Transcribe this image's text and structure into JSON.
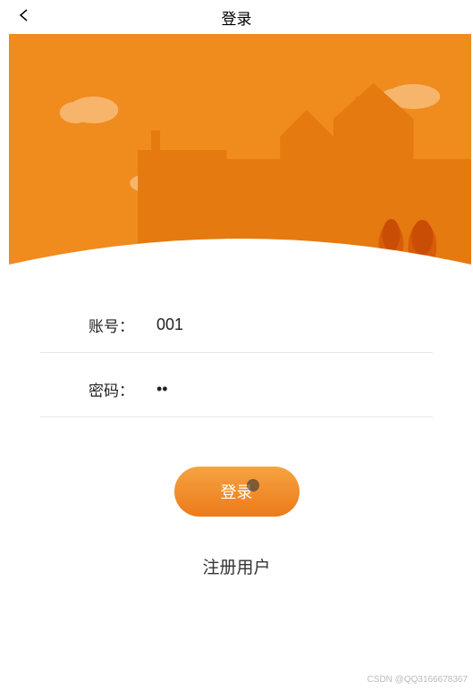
{
  "header": {
    "title": "登录"
  },
  "form": {
    "account_label": "账号：",
    "account_value": "001",
    "password_label": "密码：",
    "password_value": "••"
  },
  "buttons": {
    "login_label": "登录",
    "register_label": "注册用户"
  },
  "watermark": "CSDN @QQ3166678367",
  "colors": {
    "accent": "#f08b1e",
    "accent_light": "#f4a341"
  }
}
